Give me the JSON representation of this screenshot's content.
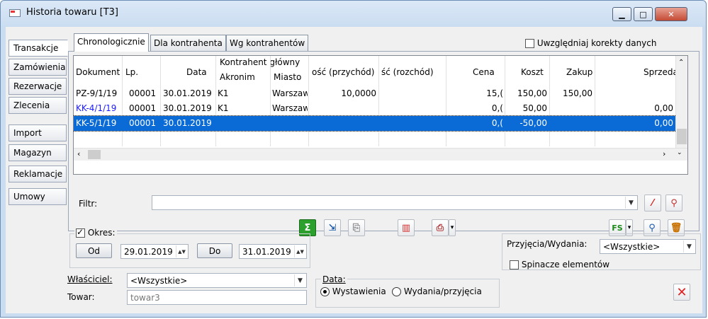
{
  "window": {
    "title": "Historia towaru [T3]",
    "min": "▁",
    "max": "□",
    "close": "✕"
  },
  "side_tabs": [
    "Transakcje",
    "Zamówienia",
    "Rezerwacje",
    "Zlecenia",
    "Import",
    "Magazyn",
    "Reklamacje",
    "Umowy"
  ],
  "top_tabs": [
    "Chronologicznie",
    "Dla kontrahenta",
    "Wg kontrahentów"
  ],
  "correction_checkbox": {
    "label": "Uwzględniaj korekty danych",
    "checked": false
  },
  "grid": {
    "headers": {
      "dokument": "Dokument",
      "lp": "Lp.",
      "data": "Data",
      "kontrahent_glowny": "Kontrahent główny",
      "akronim": "Akronim",
      "miasto": "Miasto",
      "ilosc_przychod": "ość (przychód)",
      "ilosc_rozchod": "ść (rozchód)",
      "cena": "Cena",
      "koszt": "Koszt",
      "zakup": "Zakup",
      "sprzedaz": "Sprzedaż"
    },
    "rows": [
      {
        "dokument": "PZ-9/1/19",
        "lp": "00001",
        "data": "30.01.2019",
        "akronim": "K1",
        "miasto": "Warszaw",
        "przychod": "10,0000",
        "rozchod": "",
        "cena": "15,(",
        "koszt": "150,00",
        "zakup": "150,00",
        "sprzedaz": "",
        "color": "#000000"
      },
      {
        "dokument": "KK-4/1/19",
        "lp": "00001",
        "data": "30.01.2019",
        "akronim": "K1",
        "miasto": "Warszaw",
        "przychod": "",
        "rozchod": "",
        "cena": "0,(",
        "koszt": "50,00",
        "zakup": "",
        "sprzedaz": "0,00",
        "color": "#1a1aff"
      },
      {
        "dokument": "KK-5/1/19",
        "lp": "00001",
        "data": "30.01.2019",
        "akronim": "",
        "miasto": "",
        "przychod": "",
        "rozchod": "",
        "cena": "0,(",
        "koszt": "-50,00",
        "zakup": "",
        "sprzedaz": "0,00",
        "color": "#ffffff"
      }
    ],
    "selected_row": 2
  },
  "filter": {
    "label": "Filtr:",
    "value": ""
  },
  "toolbar_icons": [
    "sum-icon",
    "export-icon",
    "attach-icon",
    "columns-icon",
    "print-icon",
    "fs-icon",
    "search-icon",
    "trash-icon"
  ],
  "okres": {
    "label": "Okres:",
    "checked": true,
    "od_label": "Od",
    "od_value": "29.01.2019",
    "do_label": "Do",
    "do_value": "31.01.2019"
  },
  "przyjecia": {
    "label": "Przyjęcia/Wydania:",
    "value": "<Wszystkie>"
  },
  "spinacze": {
    "label": "Spinacze elementów",
    "checked": false
  },
  "wlasciciel": {
    "label": "Właściciel:",
    "value": "<Wszystkie>"
  },
  "towar": {
    "label": "Towar:",
    "value": "towar3"
  },
  "data_group": {
    "label": "Data:",
    "opt1": "Wystawienia",
    "opt2": "Wydania/przyjęcia",
    "selected": "Wystawienia"
  },
  "colors": {
    "accent": "#0a6ad6",
    "close": "#e02020"
  }
}
